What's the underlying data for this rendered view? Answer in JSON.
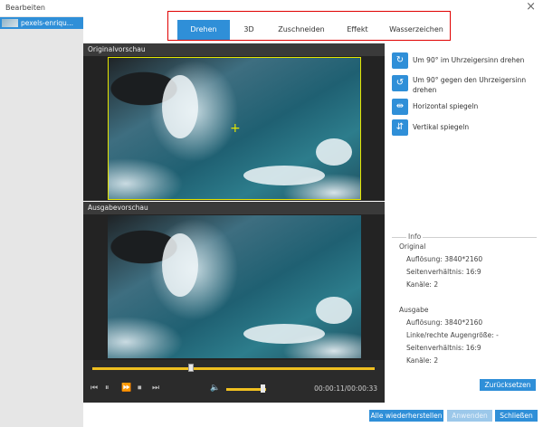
{
  "window": {
    "title": "Bearbeiten",
    "close_icon": "×"
  },
  "sidebar": {
    "items": [
      {
        "label": "pexels-enriqu..."
      }
    ]
  },
  "tabs": [
    {
      "label": "Drehen",
      "active": true
    },
    {
      "label": "3D"
    },
    {
      "label": "Zuschneiden"
    },
    {
      "label": "Effekt"
    },
    {
      "label": "Wasserzeichen"
    }
  ],
  "preview": {
    "original_label": "Originalvorschau",
    "output_label": "Ausgabevorschau"
  },
  "player": {
    "progress_fraction": 0.35,
    "volume_fraction": 0.9,
    "time": "00:00:11/00:00:33"
  },
  "rotation": {
    "items": [
      {
        "label": "Um 90° im Uhrzeigersinn drehen",
        "icon": "rotate-cw-icon",
        "glyph": "↻"
      },
      {
        "label": "Um 90° gegen den Uhrzeigersinn drehen",
        "icon": "rotate-ccw-icon",
        "glyph": "↺"
      },
      {
        "label": "Horizontal spiegeln",
        "icon": "flip-horizontal-icon",
        "glyph": "⇹"
      },
      {
        "label": "Vertikal spiegeln",
        "icon": "flip-vertical-icon",
        "glyph": "⇵"
      }
    ]
  },
  "info": {
    "legend": "Info",
    "original_heading": "Original",
    "original": {
      "resolution": "Auflösung: 3840*2160",
      "aspect": "Seitenverhältnis: 16:9",
      "channels": "Kanäle: 2"
    },
    "output_heading": "Ausgabe",
    "output": {
      "resolution": "Auflösung: 3840*2160",
      "eye_size": "Linke/rechte Augengröße: -",
      "aspect": "Seitenverhältnis: 16:9",
      "channels": "Kanäle: 2"
    }
  },
  "buttons": {
    "reset": "Zurücksetzen",
    "restore_all": "Alle wiederherstellen",
    "apply": "Anwenden",
    "close": "Schließen"
  },
  "colors": {
    "accent": "#2f8fd8",
    "highlight": "#e00000",
    "timeline": "#f0c020"
  }
}
